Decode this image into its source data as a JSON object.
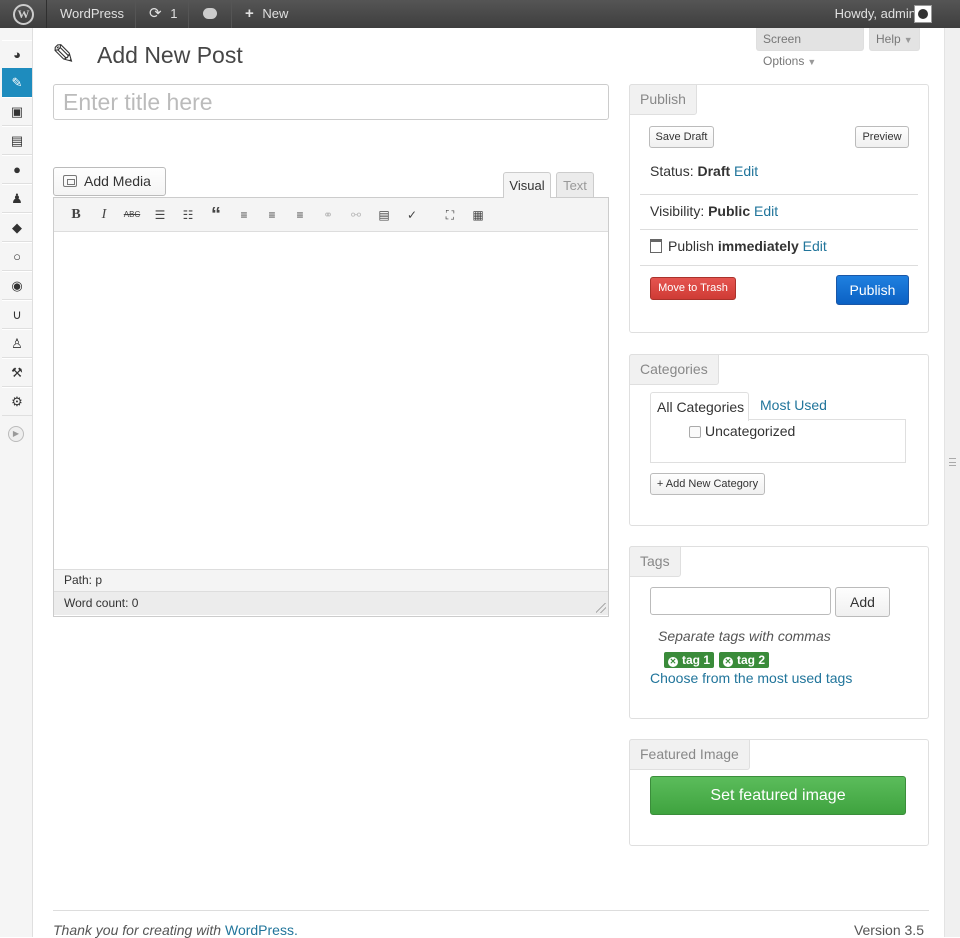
{
  "admin_bar": {
    "site_name": "WordPress",
    "updates_count": "1",
    "new_label": "New",
    "howdy": "Howdy, admin"
  },
  "header": {
    "title": "Add New Post",
    "screen_options": "Screen Options",
    "help": "Help"
  },
  "title_field": {
    "placeholder": "Enter title here"
  },
  "editor": {
    "add_media": "Add Media",
    "tab_visual": "Visual",
    "tab_text": "Text",
    "path": "Path: p",
    "word_count": "Word count: 0",
    "toolbar": [
      {
        "name": "bold-icon",
        "glyph": "B"
      },
      {
        "name": "italic-icon",
        "glyph": "I"
      },
      {
        "name": "strikethrough-icon",
        "glyph": "ABC"
      },
      {
        "name": "bulleted-list-icon",
        "glyph": "☰"
      },
      {
        "name": "numbered-list-icon",
        "glyph": "☷"
      },
      {
        "name": "blockquote-icon",
        "glyph": "“"
      },
      {
        "name": "align-left-icon",
        "glyph": "≡"
      },
      {
        "name": "align-center-icon",
        "glyph": "≡"
      },
      {
        "name": "align-right-icon",
        "glyph": "≡"
      },
      {
        "name": "insert-link-icon",
        "glyph": "⚭"
      },
      {
        "name": "unlink-icon",
        "glyph": "⚯"
      },
      {
        "name": "insert-more-icon",
        "glyph": "▤"
      },
      {
        "name": "spellcheck-icon",
        "glyph": "✓"
      },
      {
        "name": "fullscreen-icon",
        "glyph": "⛶"
      },
      {
        "name": "kitchen-sink-icon",
        "glyph": "▦"
      }
    ]
  },
  "publish_box": {
    "heading": "Publish",
    "save_draft": "Save Draft",
    "preview": "Preview",
    "status_label": "Status:",
    "status_value": "Draft",
    "visibility_label": "Visibility:",
    "visibility_value": "Public",
    "schedule_label": "Publish",
    "schedule_value": "immediately",
    "edit": "Edit",
    "move_to_trash": "Move to Trash",
    "publish_button": "Publish"
  },
  "categories_box": {
    "heading": "Categories",
    "tab_all": "All Categories",
    "tab_most_used": "Most Used",
    "items": [
      "Uncategorized"
    ],
    "add_new": "+ Add New Category"
  },
  "tags_box": {
    "heading": "Tags",
    "add_button": "Add",
    "hint": "Separate tags with commas",
    "tags": [
      "tag 1",
      "tag 2"
    ],
    "choose_link": "Choose from the most used tags"
  },
  "featured_image_box": {
    "heading": "Featured Image",
    "button": "Set featured image"
  },
  "footer": {
    "thanks": "Thank you for creating with",
    "wp_link": "WordPress.",
    "version": "Version 3.5"
  },
  "colors": {
    "accent": "#21759b",
    "active_menu": "#1e8cbe",
    "publish_button": "#0b61c4",
    "trash_button": "#cf3b35",
    "featured_button": "#4cb04c",
    "tag_chip": "#3a8b3a"
  }
}
